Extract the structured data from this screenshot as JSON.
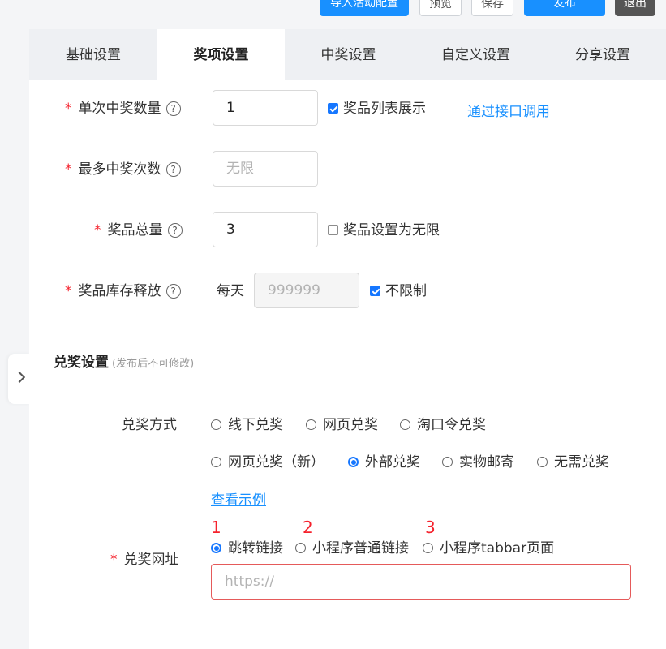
{
  "toolbar": {
    "import_label": "导入活动配置",
    "preview_label": "预览",
    "save_label": "保存",
    "publish_label": "发布",
    "exit_label": "退出"
  },
  "tabs": [
    {
      "label": "基础设置"
    },
    {
      "label": "奖项设置"
    },
    {
      "label": "中奖设置"
    },
    {
      "label": "自定义设置"
    },
    {
      "label": "分享设置"
    }
  ],
  "prize": {
    "per_win_count": {
      "label": "单次中奖数量",
      "value": "1",
      "checkbox_label": "奖品列表展示",
      "checkbox_checked": true,
      "link": "通过接口调用"
    },
    "max_win_times": {
      "label": "最多中奖次数",
      "placeholder": "无限"
    },
    "total": {
      "label": "奖品总量",
      "value": "3",
      "checkbox_label": "奖品设置为无限",
      "checkbox_checked": false
    },
    "stock_release": {
      "label": "奖品库存释放",
      "prefix": "每天",
      "placeholder": "999999",
      "checkbox_label": "不限制",
      "checkbox_checked": true
    }
  },
  "redeem": {
    "section_title": "兑奖设置",
    "section_note": "(发布后不可修改)",
    "method_label": "兑奖方式",
    "methods": [
      "线下兑奖",
      "网页兑奖",
      "淘口令兑奖",
      "网页兑奖（新）",
      "外部兑奖",
      "实物邮寄",
      "无需兑奖"
    ],
    "selected_method": "外部兑奖",
    "example_link": "查看示例",
    "url_label": "兑奖网址",
    "annotations": [
      "1",
      "2",
      "3"
    ],
    "link_types": [
      "跳转链接",
      "小程序普通链接",
      "小程序tabbar页面"
    ],
    "selected_link_type": "跳转链接",
    "url_placeholder": "https://"
  },
  "colors": {
    "accent": "#1890ff",
    "required": "#f5222d",
    "error_border": "#e55a5a"
  }
}
